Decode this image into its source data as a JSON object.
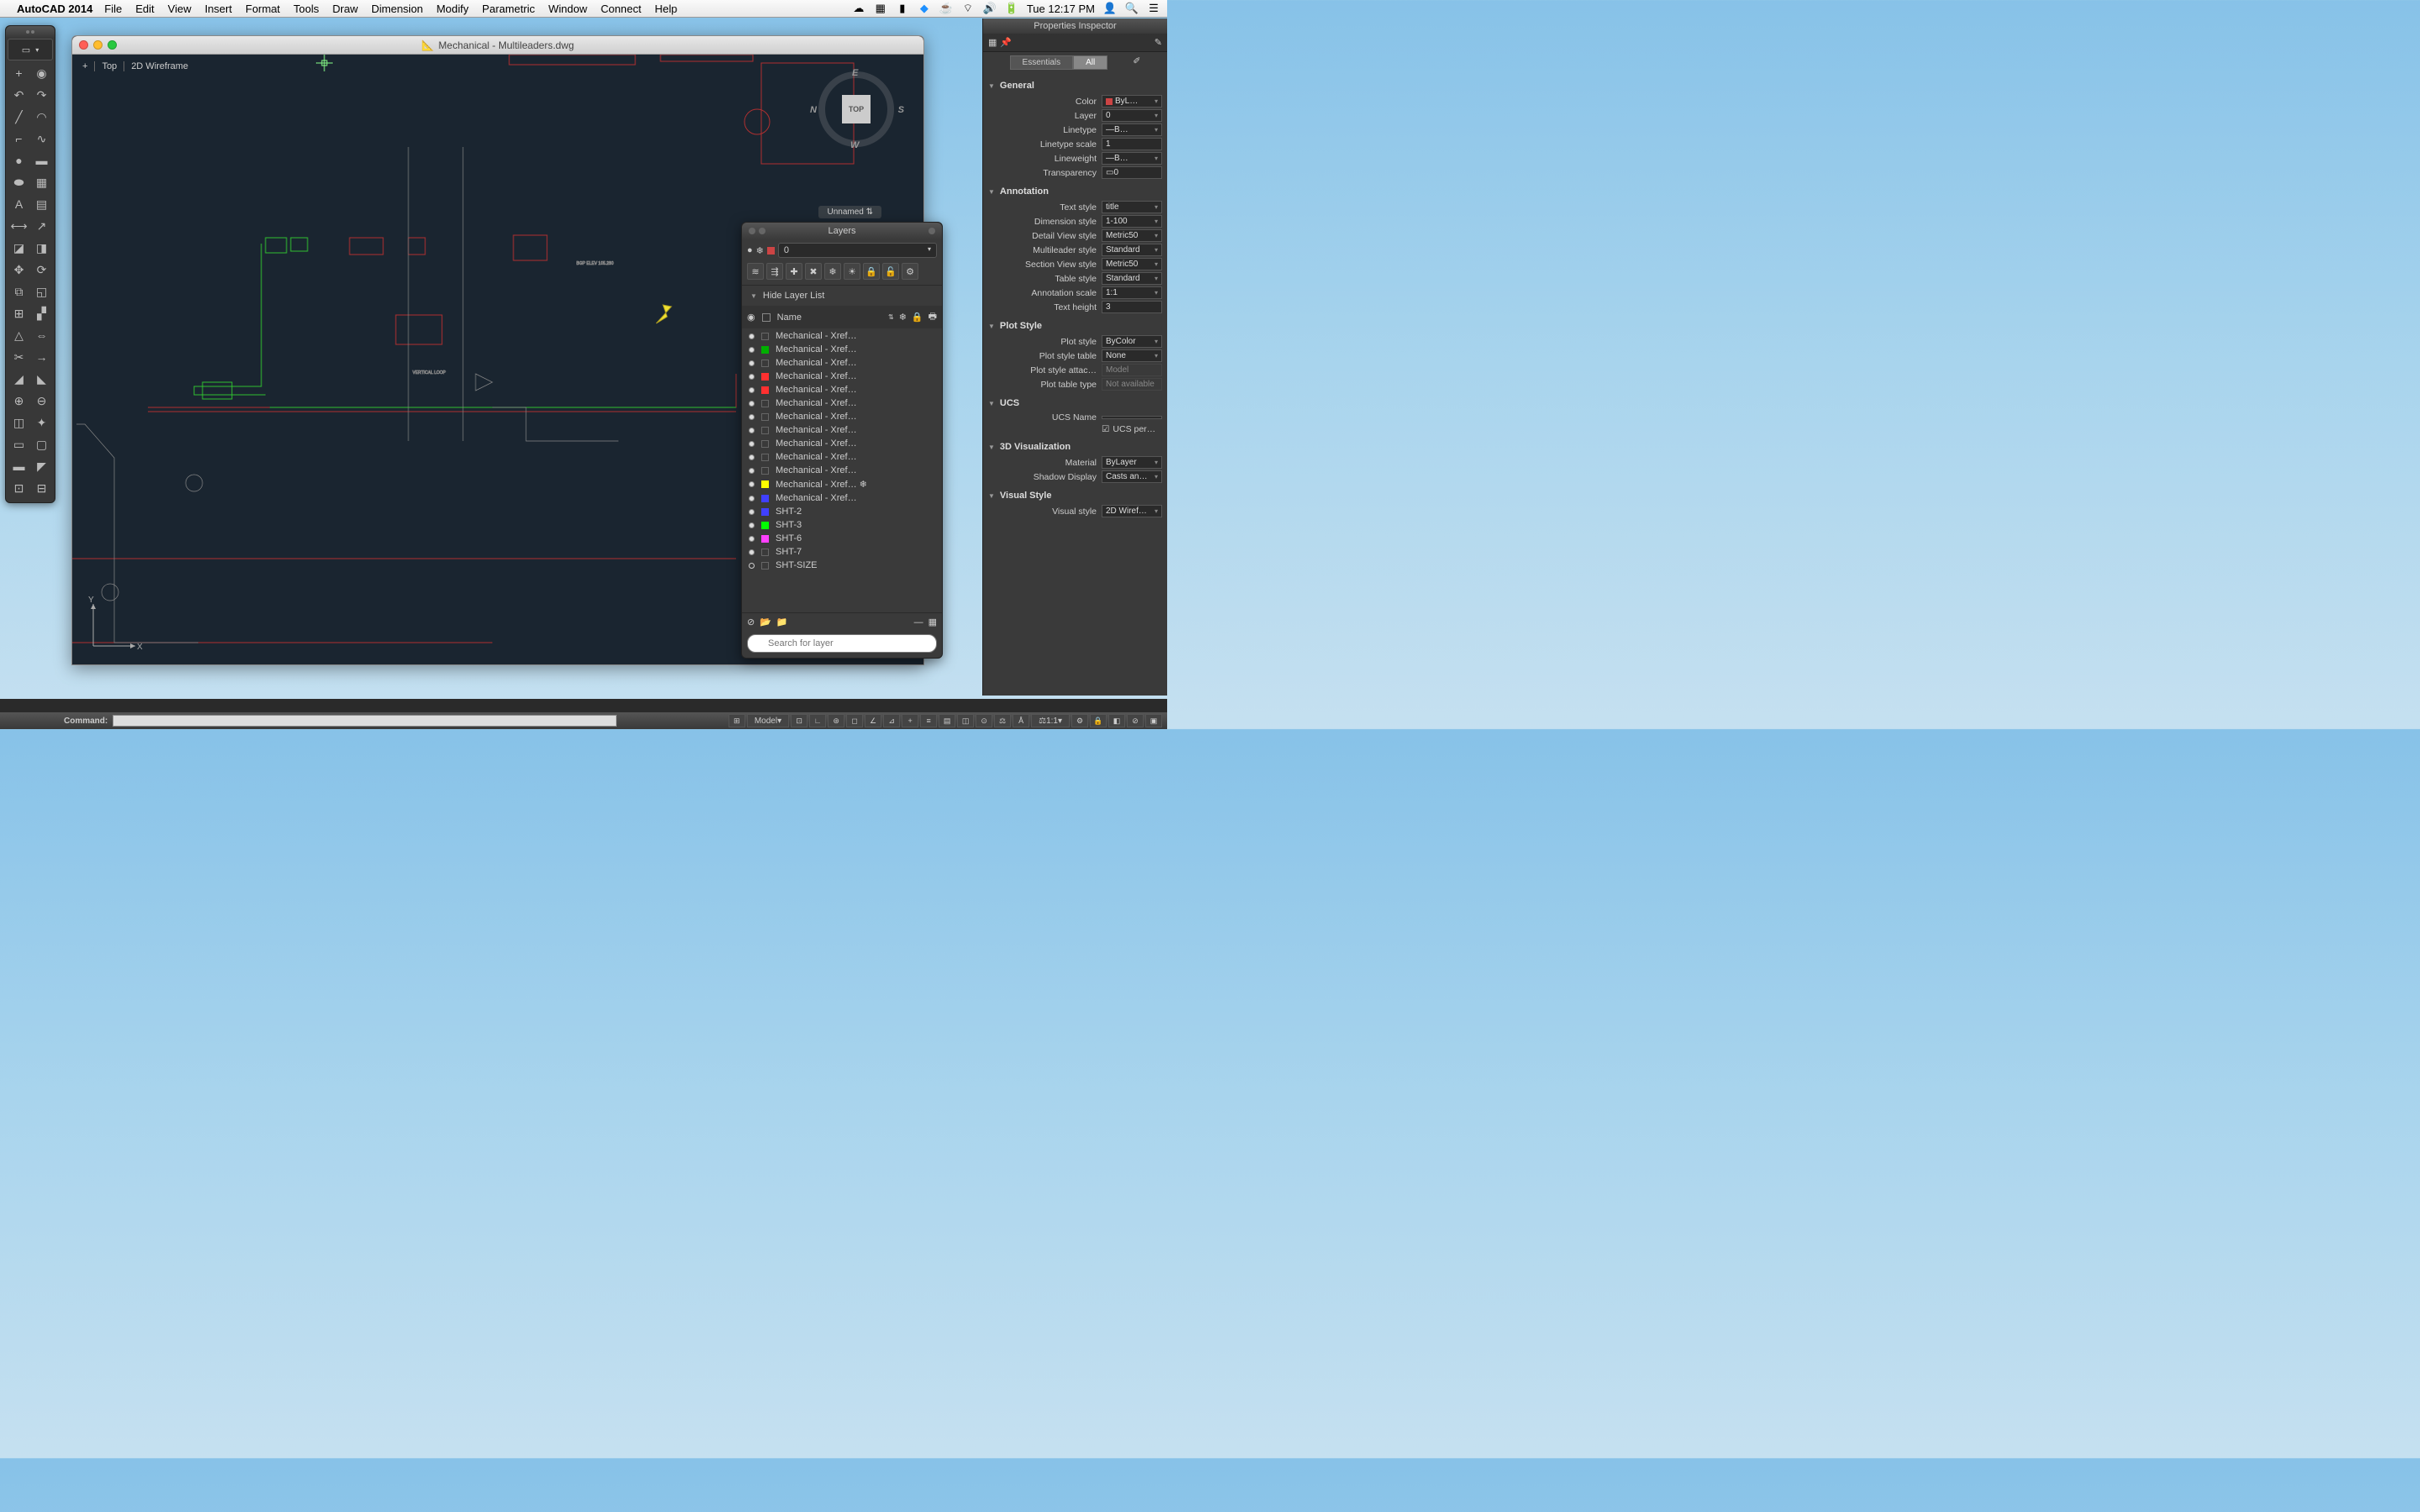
{
  "menubar": {
    "app": "AutoCAD 2014",
    "items": [
      "File",
      "Edit",
      "View",
      "Insert",
      "Format",
      "Tools",
      "Draw",
      "Dimension",
      "Modify",
      "Parametric",
      "Window",
      "Connect",
      "Help"
    ],
    "clock": "Tue 12:17 PM"
  },
  "doc": {
    "title": "Mechanical - Multileaders.dwg",
    "view1": "Top",
    "view2": "2D Wireframe",
    "viewcube": "TOP",
    "unnamed": "Unnamed"
  },
  "layers": {
    "title": "Layers",
    "current": "0",
    "hide": "Hide Layer List",
    "name_col": "Name",
    "search_placeholder": "Search for layer",
    "items": [
      {
        "c": "#ffffff",
        "n": "Mechanical - Xref…",
        "sw": ""
      },
      {
        "c": "#00ff00",
        "n": "Mechanical - Xref…",
        "sw": "#00b000"
      },
      {
        "c": "#ffffff",
        "n": "Mechanical - Xref…",
        "sw": ""
      },
      {
        "c": "#ff3030",
        "n": "Mechanical - Xref…",
        "sw": "#ff3030"
      },
      {
        "c": "#ff3030",
        "n": "Mechanical - Xref…",
        "sw": "#ff3030"
      },
      {
        "c": "#ffffff",
        "n": "Mechanical - Xref…",
        "sw": ""
      },
      {
        "c": "#ffffff",
        "n": "Mechanical - Xref…",
        "sw": ""
      },
      {
        "c": "#ffffff",
        "n": "Mechanical - Xref…",
        "sw": ""
      },
      {
        "c": "#ffffff",
        "n": "Mechanical - Xref…",
        "sw": ""
      },
      {
        "c": "#ffffff",
        "n": "Mechanical - Xref…",
        "sw": ""
      },
      {
        "c": "#ffffff",
        "n": "Mechanical - Xref…",
        "sw": ""
      },
      {
        "c": "#ffff00",
        "n": "Mechanical - Xref… ❄",
        "sw": "#ffff00"
      },
      {
        "c": "#4040ff",
        "n": "Mechanical - Xref…",
        "sw": "#4040ff"
      },
      {
        "c": "#4040ff",
        "n": "SHT-2",
        "sw": "#4040ff"
      },
      {
        "c": "#00ff00",
        "n": "SHT-3",
        "sw": "#00ff00"
      },
      {
        "c": "#ff40ff",
        "n": "SHT-6",
        "sw": "#ff40ff"
      },
      {
        "c": "#ffffff",
        "n": "SHT-7",
        "sw": ""
      },
      {
        "c": "#ffffff",
        "n": "SHT-SIZE",
        "sw": "",
        "open": true
      }
    ]
  },
  "props": {
    "title": "Properties Inspector",
    "tabs": {
      "essentials": "Essentials",
      "all": "All"
    },
    "sections": {
      "general": {
        "title": "General",
        "color": {
          "l": "Color",
          "v": "ByL…"
        },
        "layer": {
          "l": "Layer",
          "v": "0"
        },
        "linetype": {
          "l": "Linetype",
          "v": "B…"
        },
        "ltscale": {
          "l": "Linetype scale",
          "v": "1"
        },
        "lineweight": {
          "l": "Lineweight",
          "v": "B…"
        },
        "transparency": {
          "l": "Transparency",
          "v": "0"
        }
      },
      "annotation": {
        "title": "Annotation",
        "textstyle": {
          "l": "Text style",
          "v": "title"
        },
        "dimstyle": {
          "l": "Dimension style",
          "v": "1-100"
        },
        "detail": {
          "l": "Detail View style",
          "v": "Metric50"
        },
        "mleader": {
          "l": "Multileader style",
          "v": "Standard"
        },
        "section": {
          "l": "Section View style",
          "v": "Metric50"
        },
        "table": {
          "l": "Table style",
          "v": "Standard"
        },
        "annoscale": {
          "l": "Annotation scale",
          "v": "1:1"
        },
        "textheight": {
          "l": "Text height",
          "v": "3"
        }
      },
      "plot": {
        "title": "Plot Style",
        "plotstyle": {
          "l": "Plot style",
          "v": "ByColor"
        },
        "plottable": {
          "l": "Plot style table",
          "v": "None"
        },
        "plotattach": {
          "l": "Plot style attac…",
          "v": "Model"
        },
        "plottype": {
          "l": "Plot table type",
          "v": "Not available"
        }
      },
      "ucs": {
        "title": "UCS",
        "name": {
          "l": "UCS Name",
          "v": ""
        },
        "per": {
          "l": "UCS per…"
        }
      },
      "viz3d": {
        "title": "3D Visualization",
        "material": {
          "l": "Material",
          "v": "ByLayer"
        },
        "shadow": {
          "l": "Shadow Display",
          "v": "Casts an…"
        }
      },
      "visual": {
        "title": "Visual Style",
        "vs": {
          "l": "Visual style",
          "v": "2D Wiref…"
        }
      }
    }
  },
  "status": {
    "cmd": "Command:",
    "model": "Model",
    "scale": "1:1"
  }
}
